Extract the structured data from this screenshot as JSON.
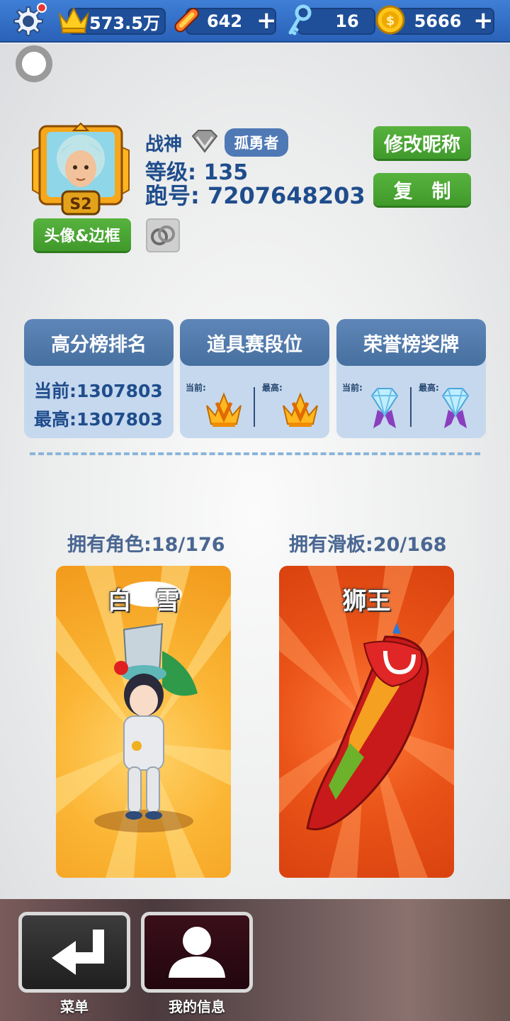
{
  "currency": {
    "crowns": "573.5万",
    "skateboards": "642",
    "keys": "16",
    "coins": "5666",
    "plus": "+"
  },
  "profile": {
    "name": "战神",
    "title_badge": "孤勇者",
    "level_label": "等级:",
    "level": "135",
    "id_label": "跑号:",
    "id": "7207648203",
    "season_badge": "S2",
    "rename_button": "修改昵称",
    "copy_button": "复　制",
    "avatar_frame_button": "头像&边框"
  },
  "cards": {
    "leaderboard": {
      "title": "高分榜排名",
      "current": "当前:1307803",
      "best": "最高:1307803"
    },
    "item_race": {
      "title": "道具赛段位",
      "current_label": "当前:",
      "best_label": "最高:"
    },
    "honor": {
      "title": "荣誉榜奖牌",
      "current_label": "当前:",
      "best_label": "最高:"
    }
  },
  "collection": {
    "characters": "拥有角色:18/176",
    "boards": "拥有滑板:20/168",
    "character_name": "白　雪",
    "board_name": "狮王"
  },
  "nav": {
    "menu": "菜单",
    "my_info": "我的信息"
  },
  "colors": {
    "topbar": "#2f6cc4",
    "green_button": "#4aa634",
    "text_blue": "#1f4d8c",
    "character_bg": "#f6a325",
    "board_bg": "#e14a17"
  }
}
